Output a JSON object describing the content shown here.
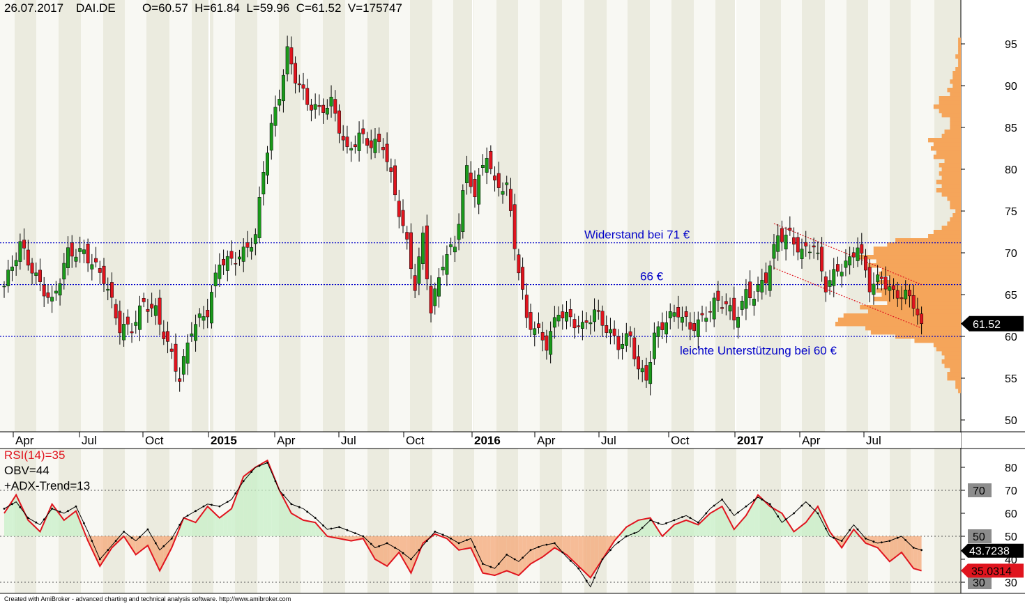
{
  "header": {
    "date": "26.07.2017",
    "symbol": "DAI.DE",
    "ohlcv": "O=60.57  H=61.84  L=59.96  C=61.52  V=175747"
  },
  "footer": "Created with AmiBroker - advanced charting and technical analysis software. http://www.amibroker.com",
  "colors": {
    "up": "#1a9a1a",
    "down": "#e0141e",
    "volume_profile": "#f5a55a",
    "hline": "#0000c8",
    "channel": "#e0141e",
    "rsi": "#e0141e",
    "obv": "#000000",
    "band_a": "#ebebdf",
    "band_b": "#f8f8f3",
    "annotation": "#0000c8"
  },
  "indicators": {
    "rsi_label": "RSI(14)=35",
    "obv_label": "OBV=44",
    "adx_label": "+ADX-Trend=13",
    "obv_value": "43.7238",
    "rsi_value": "35.0314"
  },
  "price_badge": "61.52",
  "chart_data": [
    {
      "type": "candlestick",
      "title": "",
      "ylim": [
        48.5,
        97.5
      ],
      "y_ticks": [
        50,
        55,
        60,
        65,
        70,
        75,
        80,
        85,
        90,
        95
      ],
      "x_labels": [
        {
          "text": "Apr",
          "bold": false
        },
        {
          "text": "Jul",
          "bold": false
        },
        {
          "text": "Oct",
          "bold": false
        },
        {
          "text": "2015",
          "bold": true
        },
        {
          "text": "Apr",
          "bold": false
        },
        {
          "text": "Jul",
          "bold": false
        },
        {
          "text": "Oct",
          "bold": false
        },
        {
          "text": "2016",
          "bold": true
        },
        {
          "text": "Apr",
          "bold": false
        },
        {
          "text": "Jul",
          "bold": false
        },
        {
          "text": "Oct",
          "bold": false
        },
        {
          "text": "2017",
          "bold": true
        },
        {
          "text": "Apr",
          "bold": false
        },
        {
          "text": "Jul",
          "bold": false
        }
      ],
      "series": [
        {
          "name": "",
          "keypoints": [
            [
              0,
              66
            ],
            [
              4,
              71
            ],
            [
              8,
              67
            ],
            [
              12,
              64
            ],
            [
              16,
              70
            ],
            [
              20,
              70
            ],
            [
              25,
              67
            ],
            [
              29,
              61
            ],
            [
              32,
              61
            ],
            [
              35,
              64
            ],
            [
              38,
              63
            ],
            [
              41,
              59
            ],
            [
              44,
              55
            ],
            [
              47,
              61
            ],
            [
              51,
              63
            ],
            [
              54,
              69
            ],
            [
              57,
              69
            ],
            [
              60,
              70
            ],
            [
              63,
              72
            ],
            [
              65,
              80
            ],
            [
              67,
              85
            ],
            [
              69,
              89
            ],
            [
              71,
              94
            ],
            [
              73,
              91
            ],
            [
              76,
              88
            ],
            [
              79,
              87
            ],
            [
              82,
              88
            ],
            [
              84,
              85
            ],
            [
              86,
              82
            ],
            [
              89,
              84
            ],
            [
              92,
              83
            ],
            [
              95,
              83
            ],
            [
              98,
              77
            ],
            [
              101,
              71
            ],
            [
              103,
              66
            ],
            [
              105,
              72
            ],
            [
              107,
              63
            ],
            [
              110,
              69
            ],
            [
              113,
              71
            ],
            [
              116,
              80
            ],
            [
              118,
              77
            ],
            [
              121,
              82
            ],
            [
              123,
              78
            ],
            [
              126,
              78
            ],
            [
              128,
              71
            ],
            [
              131,
              62
            ],
            [
              133,
              61
            ],
            [
              136,
              59
            ],
            [
              139,
              63
            ],
            [
              142,
              62
            ],
            [
              145,
              61
            ],
            [
              148,
              63
            ],
            [
              151,
              61
            ],
            [
              154,
              59
            ],
            [
              157,
              60
            ],
            [
              159,
              56
            ],
            [
              161,
              55
            ],
            [
              163,
              60
            ],
            [
              166,
              62
            ],
            [
              169,
              63
            ],
            [
              172,
              61
            ],
            [
              175,
              62
            ],
            [
              178,
              64
            ],
            [
              181,
              64
            ],
            [
              183,
              62
            ],
            [
              186,
              65
            ],
            [
              188,
              65
            ],
            [
              191,
              67
            ],
            [
              194,
              72
            ],
            [
              197,
              72
            ],
            [
              200,
              70
            ],
            [
              203,
              71
            ],
            [
              206,
              66
            ],
            [
              209,
              68
            ],
            [
              212,
              69
            ],
            [
              214,
              71
            ],
            [
              217,
              66
            ],
            [
              220,
              67
            ],
            [
              223,
              65
            ],
            [
              226,
              65
            ],
            [
              228,
              64
            ],
            [
              230,
              61.5
            ]
          ],
          "high_line_at": [
            71,
            126
          ],
          "low_at": 161
        }
      ],
      "annotations": [
        {
          "text": "Widerstand bei 71 €",
          "y": 71.2
        },
        {
          "text": "66 €",
          "y": 66.2
        },
        {
          "text": "leichte Unterstützung bei 60 €",
          "y": 60
        }
      ],
      "hlines": [
        71.2,
        66.2,
        60
      ],
      "channel": {
        "upper": [
          [
            193,
            73.5
          ],
          [
            230,
            66.2
          ]
        ],
        "lower": [
          [
            193,
            68.2
          ],
          [
            230,
            61
          ]
        ]
      },
      "volume_profile": true
    },
    {
      "type": "line",
      "title": "",
      "ylim": [
        27,
        86
      ],
      "y_ticks": [
        30,
        40,
        50,
        60,
        70,
        80
      ],
      "hlines": [
        30,
        50,
        70
      ],
      "badges": [
        70,
        50,
        30
      ],
      "series": [
        {
          "name": "RSI(14)",
          "keypoints": [
            [
              0,
              60
            ],
            [
              3,
              68
            ],
            [
              6,
              57
            ],
            [
              9,
              52
            ],
            [
              12,
              64
            ],
            [
              15,
              57
            ],
            [
              18,
              61
            ],
            [
              21,
              48
            ],
            [
              24,
              37
            ],
            [
              27,
              45
            ],
            [
              30,
              50
            ],
            [
              33,
              42
            ],
            [
              36,
              46
            ],
            [
              39,
              35
            ],
            [
              42,
              45
            ],
            [
              45,
              58
            ],
            [
              48,
              56
            ],
            [
              51,
              63
            ],
            [
              54,
              58
            ],
            [
              57,
              62
            ],
            [
              60,
              76
            ],
            [
              63,
              80
            ],
            [
              66,
              83
            ],
            [
              69,
              70
            ],
            [
              72,
              60
            ],
            [
              75,
              57
            ],
            [
              78,
              56
            ],
            [
              81,
              50
            ],
            [
              84,
              49
            ],
            [
              87,
              48
            ],
            [
              90,
              49
            ],
            [
              93,
              40
            ],
            [
              96,
              37
            ],
            [
              99,
              43
            ],
            [
              102,
              34
            ],
            [
              105,
              47
            ],
            [
              108,
              51
            ],
            [
              111,
              49
            ],
            [
              114,
              44
            ],
            [
              117,
              45
            ],
            [
              120,
              34
            ],
            [
              123,
              33
            ],
            [
              126,
              35
            ],
            [
              129,
              33
            ],
            [
              132,
              38
            ],
            [
              135,
              41
            ],
            [
              138,
              45
            ],
            [
              141,
              42
            ],
            [
              144,
              37
            ],
            [
              147,
              32
            ],
            [
              150,
              40
            ],
            [
              153,
              48
            ],
            [
              156,
              54
            ],
            [
              159,
              57
            ],
            [
              162,
              58
            ],
            [
              165,
              50
            ],
            [
              168,
              55
            ],
            [
              171,
              57
            ],
            [
              174,
              55
            ],
            [
              177,
              60
            ],
            [
              180,
              63
            ],
            [
              183,
              53
            ],
            [
              186,
              59
            ],
            [
              189,
              68
            ],
            [
              192,
              63
            ],
            [
              195,
              60
            ],
            [
              198,
              52
            ],
            [
              201,
              56
            ],
            [
              204,
              63
            ],
            [
              207,
              52
            ],
            [
              210,
              45
            ],
            [
              213,
              53
            ],
            [
              216,
              47
            ],
            [
              219,
              45
            ],
            [
              222,
              39
            ],
            [
              225,
              43
            ],
            [
              228,
              36
            ],
            [
              230,
              35
            ]
          ]
        },
        {
          "name": "OBV",
          "keypoints": [
            [
              0,
              62
            ],
            [
              3,
              65
            ],
            [
              6,
              58
            ],
            [
              9,
              55
            ],
            [
              12,
              62
            ],
            [
              15,
              60
            ],
            [
              18,
              63
            ],
            [
              21,
              52
            ],
            [
              24,
              40
            ],
            [
              27,
              46
            ],
            [
              30,
              52
            ],
            [
              33,
              48
            ],
            [
              36,
              53
            ],
            [
              39,
              44
            ],
            [
              42,
              49
            ],
            [
              45,
              58
            ],
            [
              48,
              61
            ],
            [
              51,
              64
            ],
            [
              54,
              63
            ],
            [
              57,
              66
            ],
            [
              60,
              74
            ],
            [
              63,
              80
            ],
            [
              66,
              82
            ],
            [
              69,
              70
            ],
            [
              72,
              64
            ],
            [
              75,
              62
            ],
            [
              78,
              58
            ],
            [
              81,
              53
            ],
            [
              84,
              54
            ],
            [
              87,
              52
            ],
            [
              90,
              50
            ],
            [
              93,
              45
            ],
            [
              96,
              47
            ],
            [
              99,
              44
            ],
            [
              102,
              40
            ],
            [
              105,
              46
            ],
            [
              108,
              52
            ],
            [
              111,
              50
            ],
            [
              114,
              47
            ],
            [
              117,
              49
            ],
            [
              120,
              38
            ],
            [
              123,
              36
            ],
            [
              126,
              42
            ],
            [
              129,
              39
            ],
            [
              132,
              44
            ],
            [
              135,
              46
            ],
            [
              138,
              47
            ],
            [
              141,
              41
            ],
            [
              144,
              36
            ],
            [
              147,
              28
            ],
            [
              150,
              40
            ],
            [
              153,
              46
            ],
            [
              156,
              50
            ],
            [
              159,
              52
            ],
            [
              162,
              57
            ],
            [
              165,
              55
            ],
            [
              168,
              57
            ],
            [
              171,
              59
            ],
            [
              174,
              56
            ],
            [
              177,
              62
            ],
            [
              180,
              66
            ],
            [
              183,
              59
            ],
            [
              186,
              63
            ],
            [
              189,
              67
            ],
            [
              192,
              64
            ],
            [
              195,
              56
            ],
            [
              198,
              60
            ],
            [
              201,
              65
            ],
            [
              204,
              60
            ],
            [
              207,
              50
            ],
            [
              210,
              48
            ],
            [
              213,
              55
            ],
            [
              216,
              49
            ],
            [
              219,
              47
            ],
            [
              222,
              48
            ],
            [
              225,
              50
            ],
            [
              228,
              45
            ],
            [
              230,
              44
            ]
          ]
        }
      ]
    }
  ]
}
